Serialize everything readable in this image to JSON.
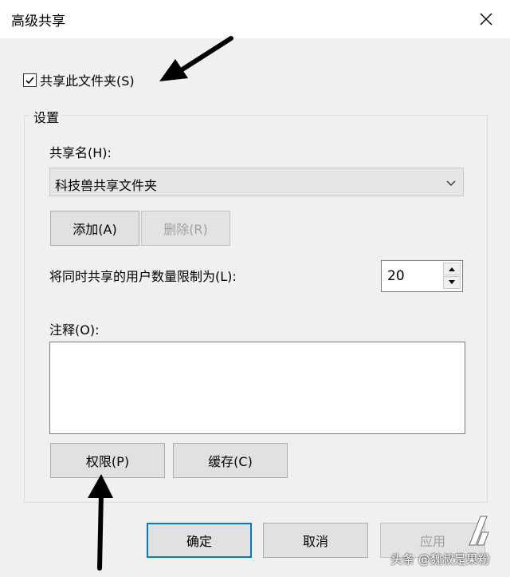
{
  "window": {
    "title": "高级共享",
    "close_icon": "close-icon"
  },
  "share_checkbox": {
    "label": "共享此文件夹(S)",
    "checked": true
  },
  "settings": {
    "group_label": "设置",
    "share_name_label": "共享名(H):",
    "share_name_value": "科技兽共享文件夹",
    "add_button": "添加(A)",
    "remove_button": "删除(R)",
    "user_limit_label": "将同时共享的用户数量限制为(L):",
    "user_limit_value": "20",
    "comment_label": "注释(O):",
    "comment_value": "",
    "permissions_button": "权限(P)",
    "caching_button": "缓存(C)"
  },
  "footer": {
    "ok_button": "确定",
    "cancel_button": "取消",
    "apply_button": "应用"
  },
  "watermark": {
    "text": "头条 @魏叔是果粉"
  },
  "colors": {
    "accent": "#0078d7",
    "dialog_bg": "#f0f0f0",
    "disabled_text": "#a0a0a0"
  }
}
